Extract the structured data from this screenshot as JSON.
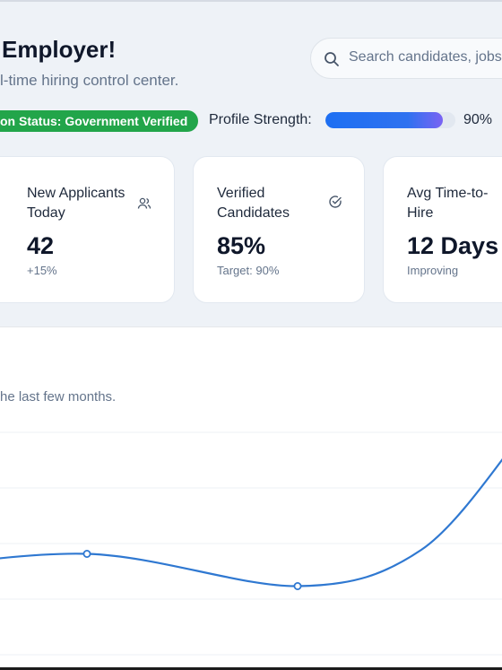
{
  "header": {
    "title": "Employer!",
    "subtitle": "l-time hiring control center.",
    "search_placeholder": "Search candidates, jobs..."
  },
  "status": {
    "badge": "on Status: Government Verified",
    "profile_strength_label": "Profile Strength:",
    "profile_strength_value": "90%",
    "profile_strength_fraction": 0.9,
    "badge_color": "#22a54a",
    "accent": "#1d6ff2"
  },
  "cards": [
    {
      "title": "New Applicants Today",
      "value": "42",
      "sub": "+15%",
      "icon": "users-icon"
    },
    {
      "title": "Verified Candidates",
      "value": "85%",
      "sub": "Target: 90%",
      "icon": "check-circle-icon"
    },
    {
      "title": "Avg Time-to-Hire",
      "value": "12 Days",
      "sub": "Improving",
      "icon": "clock-icon"
    }
  ],
  "chart": {
    "description": "he last few months."
  },
  "chart_data": {
    "type": "line",
    "x": [
      0,
      1,
      2,
      3,
      4
    ],
    "values": [
      2.0,
      2.25,
      1.85,
      2.3,
      3.7
    ],
    "show_markers_at": [
      1,
      2
    ],
    "line_color": "#2f78d1",
    "grid": true
  }
}
